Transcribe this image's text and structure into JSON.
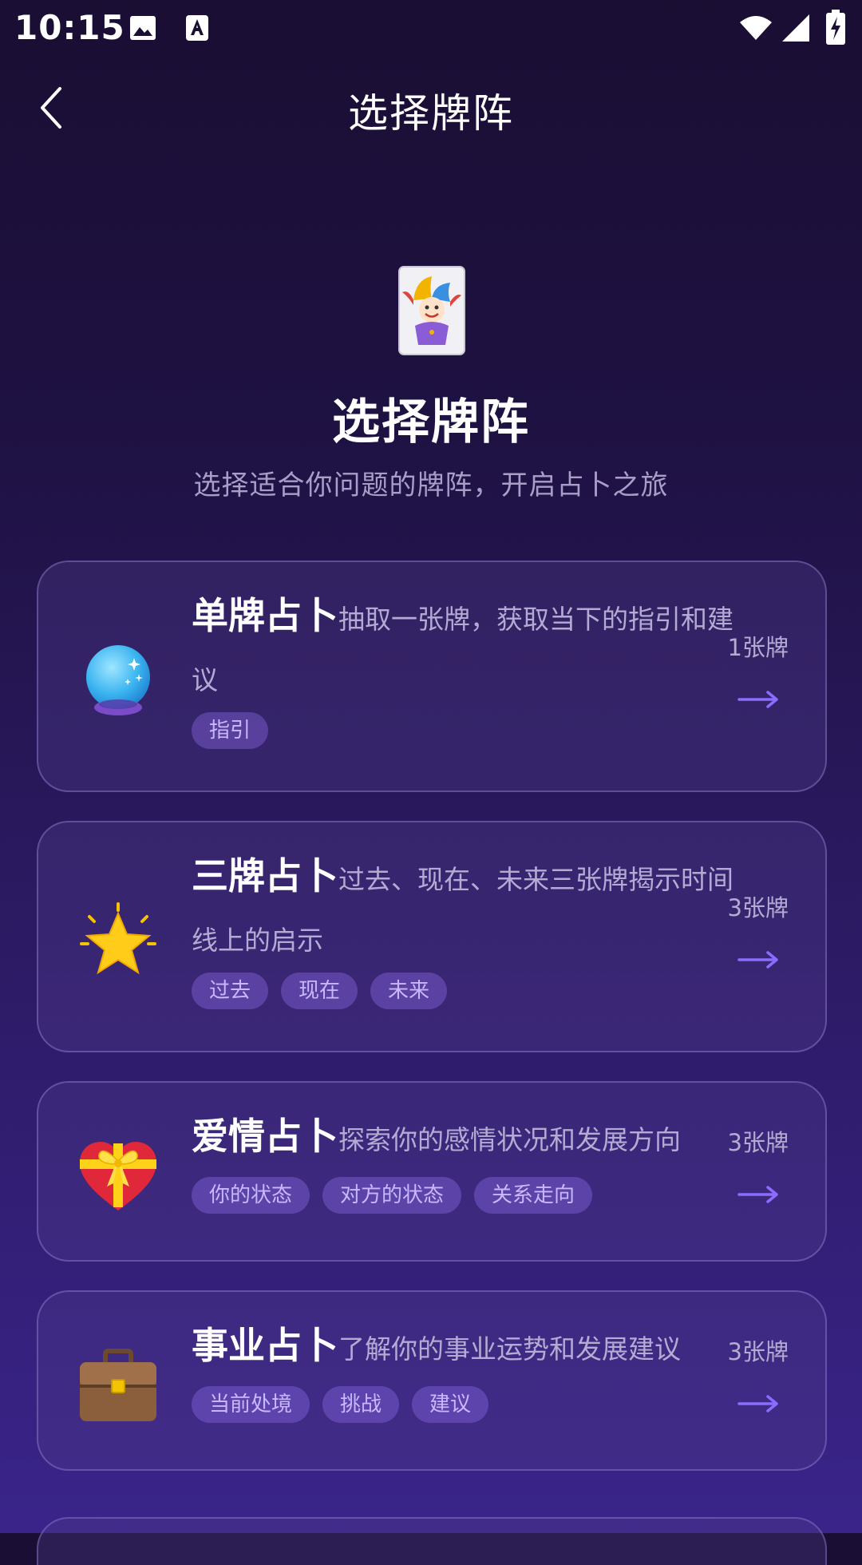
{
  "status_bar": {
    "time": "10:15"
  },
  "header": {
    "title": "选择牌阵"
  },
  "hero": {
    "title": "选择牌阵",
    "subtitle": "选择适合你问题的牌阵，开启占卜之旅"
  },
  "spreads": [
    {
      "title": "单牌占卜",
      "description": "抽取一张牌，获取当下的指引和建议",
      "tags": [
        "指引"
      ],
      "count": "1张牌",
      "icon": "crystal-ball-icon"
    },
    {
      "title": "三牌占卜",
      "description": "过去、现在、未来三张牌揭示时间线上的启示",
      "tags": [
        "过去",
        "现在",
        "未来"
      ],
      "count": "3张牌",
      "icon": "star-icon"
    },
    {
      "title": "爱情占卜",
      "description": "探索你的感情状况和发展方向",
      "tags": [
        "你的状态",
        "对方的状态",
        "关系走向"
      ],
      "count": "3张牌",
      "icon": "heart-ribbon-icon"
    },
    {
      "title": "事业占卜",
      "description": "了解你的事业运势和发展建议",
      "tags": [
        "当前处境",
        "挑战",
        "建议"
      ],
      "count": "3张牌",
      "icon": "briefcase-icon"
    }
  ],
  "colors": {
    "accent": "#8c6cff",
    "tag_text": "#c8b8ff",
    "muted_text": "#b3abd4"
  }
}
